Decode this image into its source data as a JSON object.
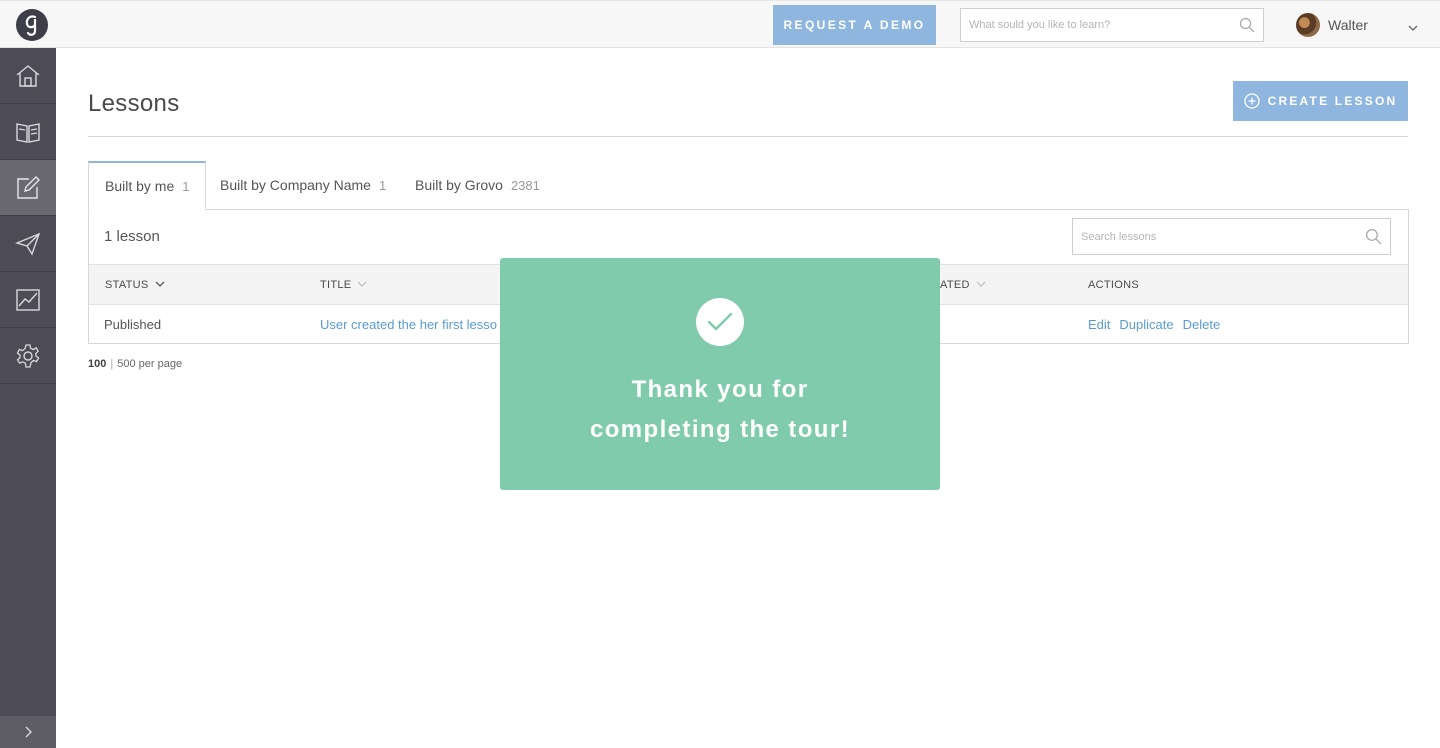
{
  "header": {
    "request_demo_label": "REQUEST A DEMO",
    "search_placeholder": "What sould you like to learn?",
    "user_name": "Walter"
  },
  "sidebar": {
    "items": [
      {
        "icon": "home-icon"
      },
      {
        "icon": "book-icon"
      },
      {
        "icon": "edit-icon",
        "active": true
      },
      {
        "icon": "paper-plane-icon"
      },
      {
        "icon": "chart-icon"
      },
      {
        "icon": "gear-icon"
      }
    ]
  },
  "main": {
    "title": "Lessons",
    "create_label": "CREATE LESSON",
    "tabs": [
      {
        "label": "Built by me",
        "count": "1"
      },
      {
        "label": "Built by Company Name",
        "count": "1"
      },
      {
        "label": "Built by Grovo",
        "count": "2381"
      }
    ],
    "lesson_count": "1 lesson",
    "search_placeholder": "Search lessons",
    "columns": {
      "status": "STATUS",
      "title": "TITLE",
      "updated": "ATED",
      "actions": "ACTIONS"
    },
    "rows": [
      {
        "status": "Published",
        "title": "User created the her first lesso",
        "actions": [
          "Edit",
          "Duplicate",
          "Delete"
        ]
      }
    ],
    "pager": {
      "option_a": "100",
      "option_b": "500",
      "suffix": "per page"
    }
  },
  "modal": {
    "line1": "Thank you for",
    "line2": "completing the tour!"
  },
  "colors": {
    "accent": "#8fb6de",
    "sidebar": "#4d4c56",
    "modal": "#7fcbab",
    "link": "#5a9bd3"
  }
}
